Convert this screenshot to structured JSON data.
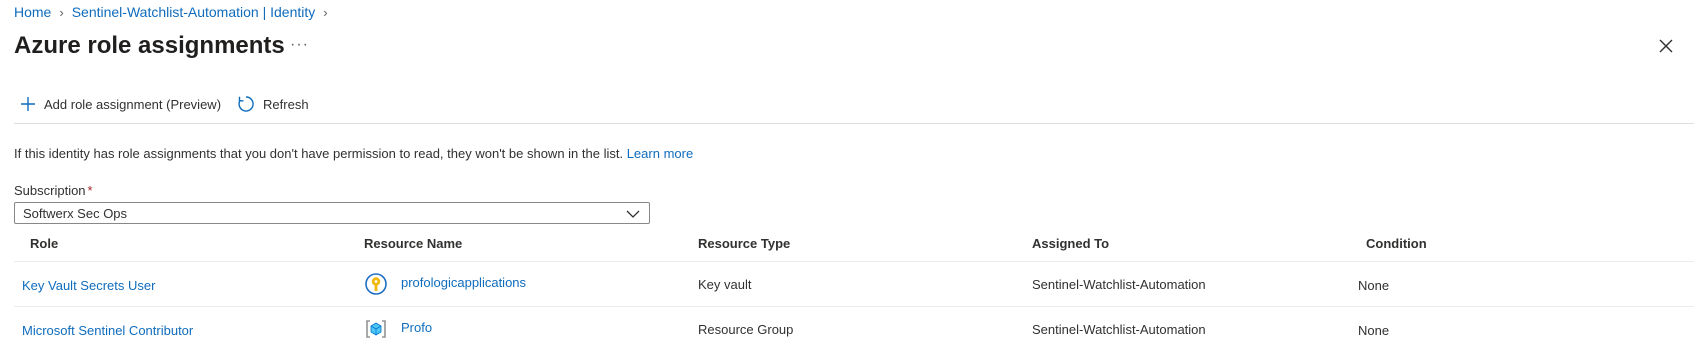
{
  "breadcrumb": {
    "home": "Home",
    "parent": "Sentinel-Watchlist-Automation | Identity"
  },
  "page_title": "Azure role assignments",
  "more_label": "···",
  "toolbar": {
    "add_label": "Add role assignment (Preview)",
    "refresh_label": "Refresh"
  },
  "info": {
    "text": "If this identity has role assignments that you don't have permission to read, they won't be shown in the list.",
    "link": "Learn more"
  },
  "subscription": {
    "label": "Subscription",
    "required_mark": "*",
    "value": "Softwerx Sec Ops"
  },
  "table": {
    "columns": [
      "Role",
      "Resource Name",
      "Resource Type",
      "Assigned To",
      "Condition"
    ],
    "rows": [
      {
        "role": "Key Vault Secrets User",
        "resource_name": "profologicapplications",
        "resource_icon": "key-vault-icon",
        "resource_type": "Key vault",
        "assigned_to": "Sentinel-Watchlist-Automation",
        "condition": "None"
      },
      {
        "role": "Microsoft Sentinel Contributor",
        "resource_name": "Profo",
        "resource_icon": "resource-group-icon",
        "resource_type": "Resource Group",
        "assigned_to": "Sentinel-Watchlist-Automation",
        "condition": "None"
      }
    ]
  },
  "colors": {
    "link": "#0f6cbd",
    "required": "#a4262c",
    "key_vault_gold": "#f2b80e",
    "resource_group_blue": "#50c7f2"
  }
}
